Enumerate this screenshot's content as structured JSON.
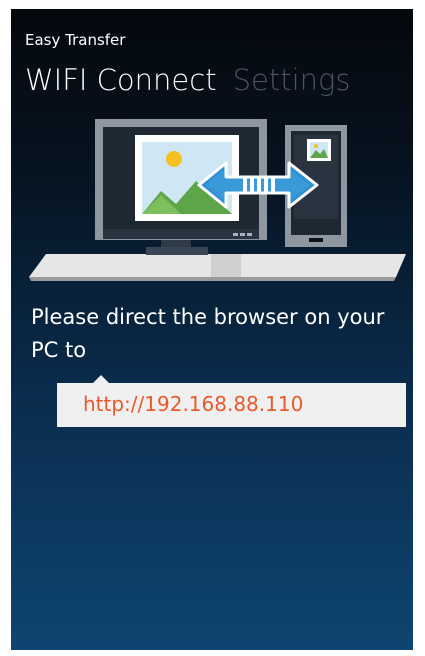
{
  "app": {
    "title": "Easy Transfer"
  },
  "pivot": {
    "active_label": "WIFI Connect",
    "inactive_label": "Settings"
  },
  "instructions": {
    "message": "Please direct the browser on your PC to",
    "url": "http://192.168.88.110"
  },
  "colors": {
    "url_text": "#e85a2a",
    "background_top": "#05080d",
    "background_bottom": "#0e4570",
    "transfer_arrow": "#3a9ad9"
  },
  "icons": {
    "illustration": "pc-phone-transfer-illustration"
  }
}
